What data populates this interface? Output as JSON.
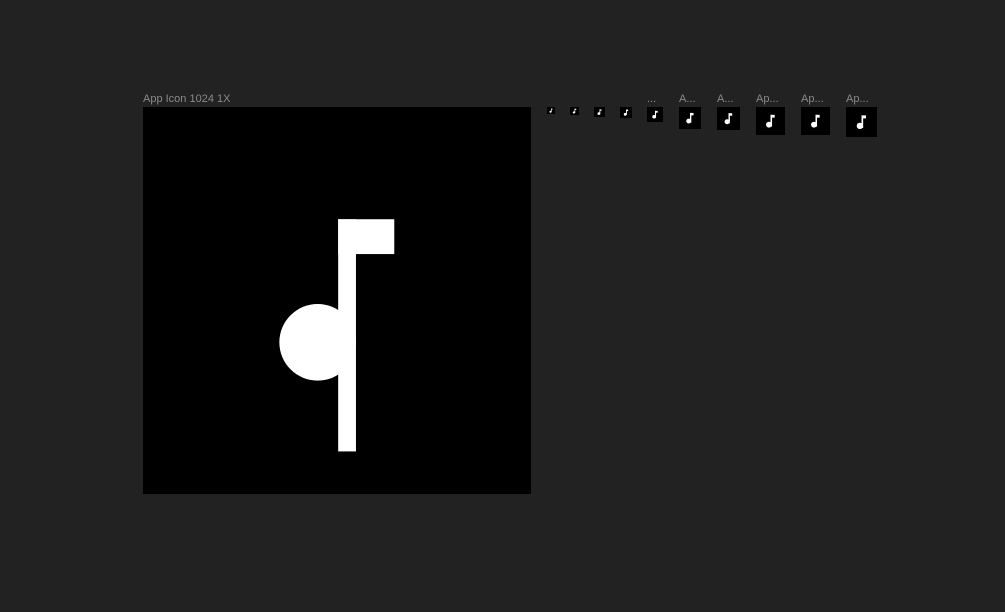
{
  "canvas": {
    "background_color": "#222222"
  },
  "artboards": [
    {
      "label": "App Icon 1024 1X",
      "icon": "music-note-icon",
      "fill": "#000000",
      "glyph_color": "#ffffff"
    },
    {
      "label": "",
      "icon": "music-note-icon"
    },
    {
      "label": "",
      "icon": "music-note-icon"
    },
    {
      "label": "",
      "icon": "music-note-icon"
    },
    {
      "label": "",
      "icon": "music-note-icon"
    },
    {
      "label": "...",
      "icon": "music-note-icon"
    },
    {
      "label": "A...",
      "icon": "music-note-icon"
    },
    {
      "label": "A...",
      "icon": "music-note-icon"
    },
    {
      "label": "Ap...",
      "icon": "music-note-icon"
    },
    {
      "label": "Ap...",
      "icon": "music-note-icon"
    },
    {
      "label": "Ap...",
      "icon": "music-note-icon"
    }
  ]
}
